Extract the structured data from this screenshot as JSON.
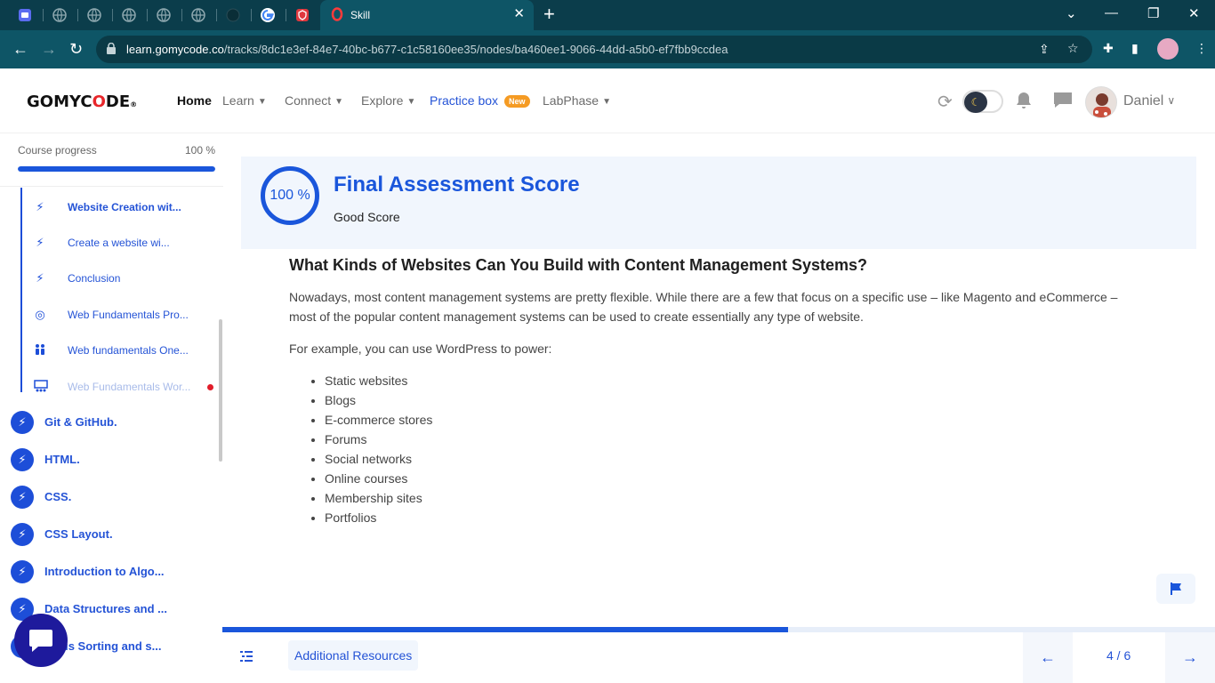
{
  "browser": {
    "active_tab_title": "Skill",
    "url_host": "learn.gomycode.co",
    "url_path": "/tracks/8dc1e3ef-84e7-40bc-b677-c1c58160ee35/nodes/ba460ee1-9066-44dd-a5b0-ef7fbb9ccdea"
  },
  "header": {
    "logo": "GOMYCODE",
    "nav": {
      "home": "Home",
      "learn": "Learn",
      "connect": "Connect",
      "explore": "Explore",
      "practice": "Practice box",
      "practice_badge": "New",
      "labphase": "LabPhase"
    },
    "user_name": "Daniel"
  },
  "sidebar": {
    "progress_label": "Course progress",
    "progress_pct": "100 %",
    "progress_value": 1.0,
    "sub_items": [
      {
        "label": "Website Creation wit...",
        "icon": "bolt-icon"
      },
      {
        "label": "Create a website wi...",
        "icon": "bolt-icon"
      },
      {
        "label": "Conclusion",
        "icon": "bolt-icon"
      },
      {
        "label": "Web Fundamentals Pro...",
        "icon": "target-icon"
      },
      {
        "label": "Web fundamentals One...",
        "icon": "people-icon"
      },
      {
        "label": "Web Fundamentals Wor...",
        "icon": "workshop-icon"
      }
    ],
    "modules": [
      {
        "label": "Git & GitHub."
      },
      {
        "label": "HTML."
      },
      {
        "label": "CSS."
      },
      {
        "label": "CSS Layout."
      },
      {
        "label": "Introduction to Algo..."
      },
      {
        "label": "Data Structures and ..."
      },
      {
        "label": "...ous Sorting and s..."
      }
    ]
  },
  "score": {
    "percent": "100 %",
    "title": "Final Assessment Score",
    "subtitle": "Good Score"
  },
  "article": {
    "heading": "What Kinds of Websites Can You Build with Content Management Systems?",
    "paragraph1": "Nowadays, most content management systems are pretty flexible. While there are a few that focus on a specific use – like Magento and eCommerce – most of the popular content management systems can be used to create essentially any type of website.",
    "paragraph2": "For example, you can use WordPress to power:",
    "list": [
      "Static websites",
      "Blogs",
      "E-commerce stores",
      "Forums",
      "Social networks",
      "Online courses",
      "Membership sites",
      "Portfolios"
    ]
  },
  "footer": {
    "resources_label": "Additional Resources",
    "page_indicator": "4 / 6",
    "progress_value": 0.57
  },
  "colors": {
    "brand_blue": "#1a56db",
    "chrome_teal": "#0e5566",
    "logo_red": "#e8262a"
  }
}
